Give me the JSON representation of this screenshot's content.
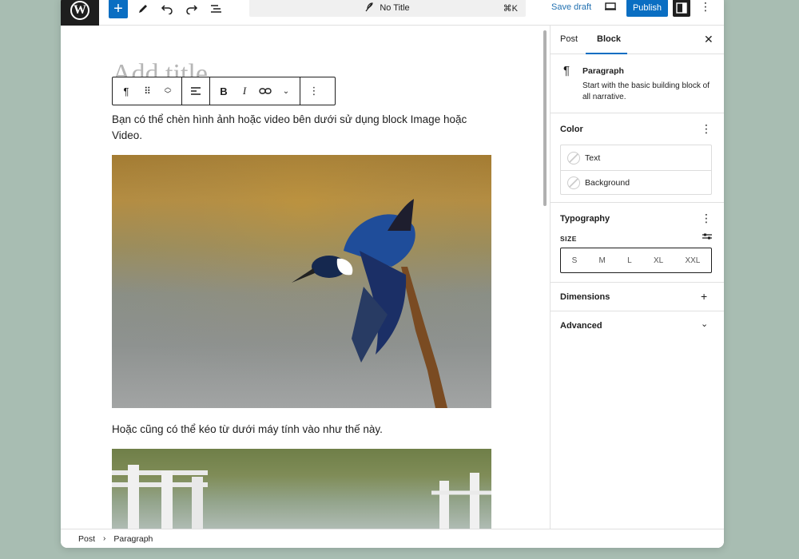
{
  "topbar": {
    "doc_title": "No Title",
    "shortcut": "⌘K",
    "save_draft": "Save draft",
    "publish": "Publish"
  },
  "canvas": {
    "title_placeholder": "Add title",
    "paragraph_1": "Bạn có thể chèn hình ảnh hoặc video bên dưới sử dụng block Image hoặc Video.",
    "paragraph_2": "Hoặc cũng có thể kéo từ dưới máy tính vào như thế này."
  },
  "sidebar": {
    "tabs": [
      "Post",
      "Block"
    ],
    "active_tab": "Block",
    "block_name": "Paragraph",
    "block_description": "Start with the basic building block of all narrative.",
    "color": {
      "title": "Color",
      "items": [
        "Text",
        "Background"
      ]
    },
    "typography": {
      "title": "Typography",
      "size_label": "SIZE",
      "sizes": [
        "S",
        "M",
        "L",
        "XL",
        "XXL"
      ]
    },
    "dimensions": "Dimensions",
    "advanced": "Advanced"
  },
  "footer": {
    "breadcrumb": [
      "Post",
      "Paragraph"
    ]
  },
  "icons": {
    "logo": "wordpress-logo",
    "add": "plus-icon",
    "tools": "pen-icon",
    "undo": "undo-icon",
    "redo": "redo-icon",
    "outline": "list-view-icon"
  },
  "colors": {
    "accent": "#0a6ec2",
    "background": "#a8bdb2"
  }
}
